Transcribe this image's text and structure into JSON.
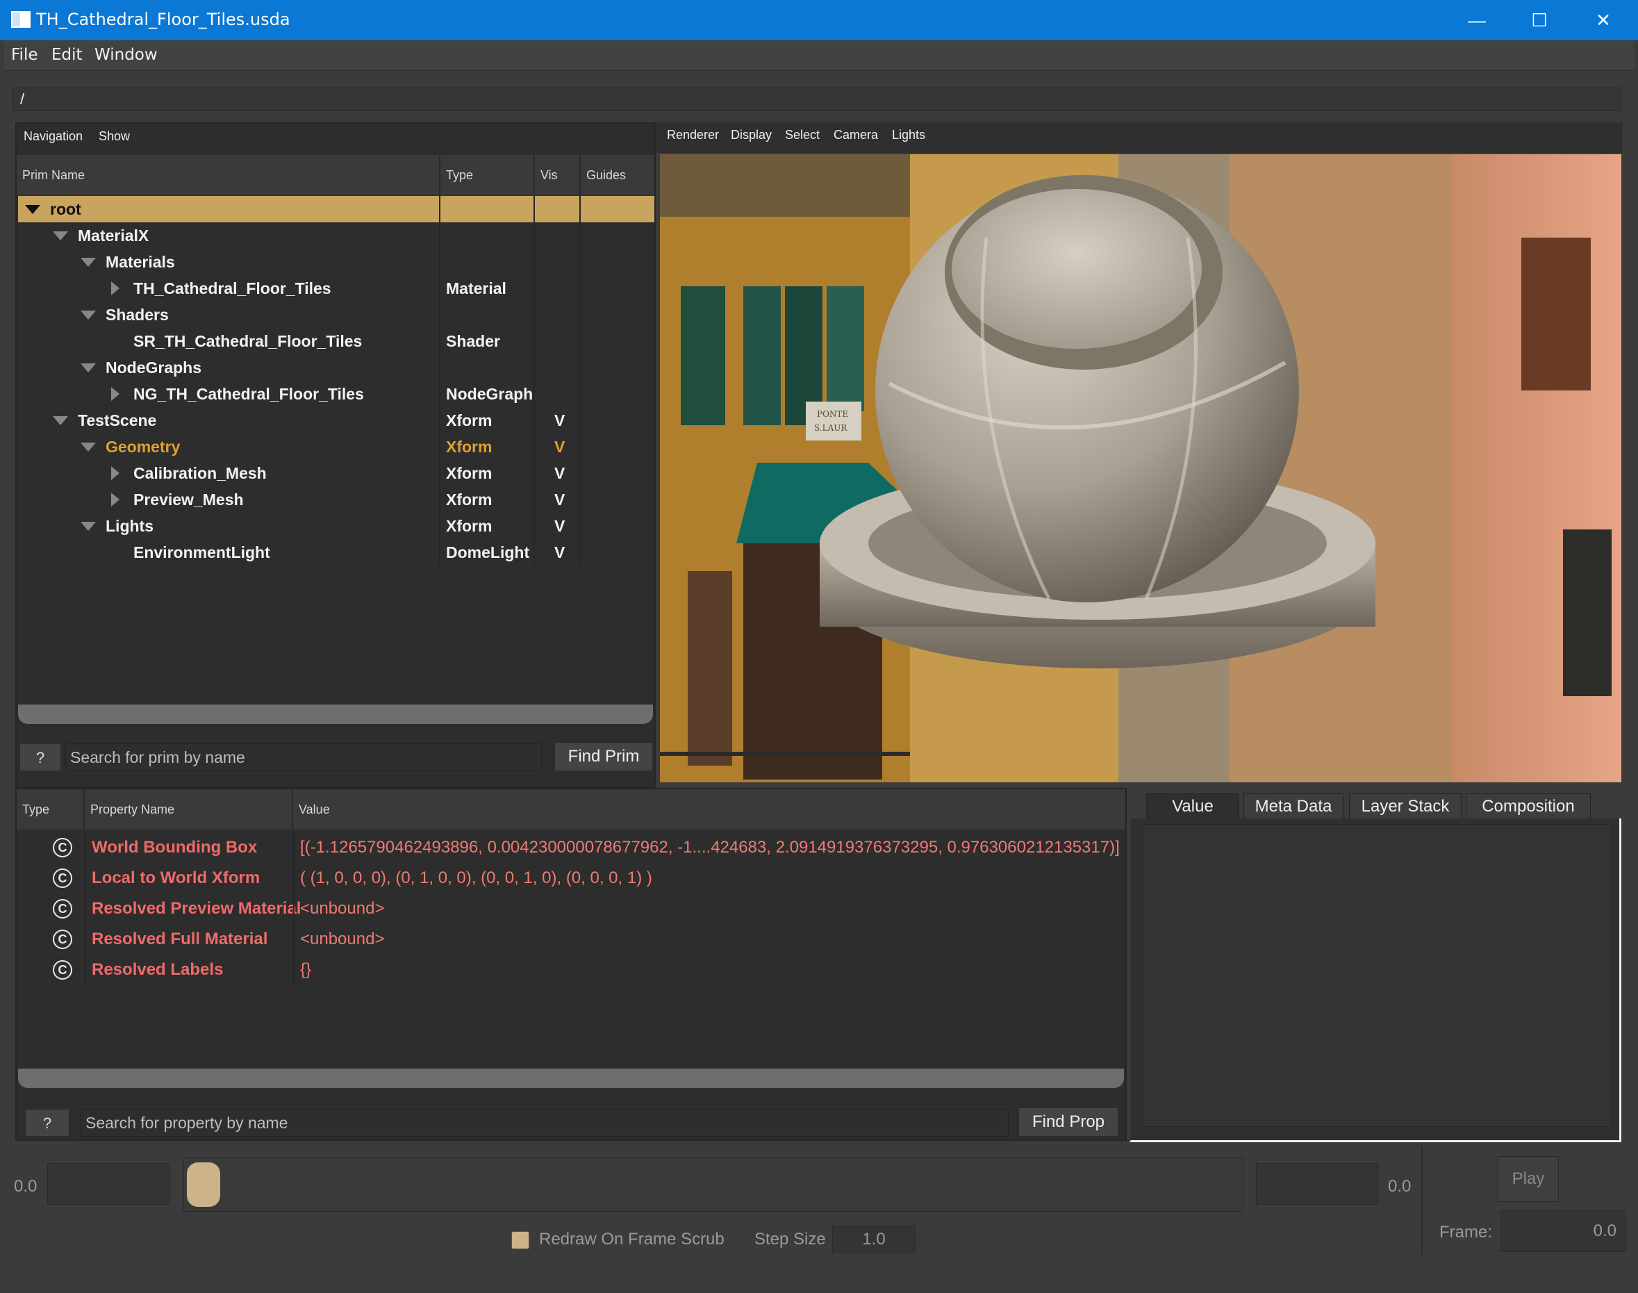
{
  "window": {
    "title": "TH_Cathedral_Floor_Tiles.usda",
    "min": "—",
    "max": "☐",
    "close": "✕"
  },
  "menubar": [
    "File",
    "Edit",
    "Window"
  ],
  "path": "/",
  "browser": {
    "menu": [
      "Navigation",
      "Show"
    ],
    "columns": [
      "Prim Name",
      "Type",
      "Vis",
      "Guides"
    ],
    "rows": [
      {
        "name": "root",
        "type": "",
        "vis": ""
      },
      {
        "name": "MaterialX",
        "type": "",
        "vis": ""
      },
      {
        "name": "Materials",
        "type": "",
        "vis": ""
      },
      {
        "name": "TH_Cathedral_Floor_Tiles",
        "type": "Material",
        "vis": ""
      },
      {
        "name": "Shaders",
        "type": "",
        "vis": ""
      },
      {
        "name": "SR_TH_Cathedral_Floor_Tiles",
        "type": "Shader",
        "vis": ""
      },
      {
        "name": "NodeGraphs",
        "type": "",
        "vis": ""
      },
      {
        "name": "NG_TH_Cathedral_Floor_Tiles",
        "type": "NodeGraph",
        "vis": ""
      },
      {
        "name": "TestScene",
        "type": "Xform",
        "vis": "V"
      },
      {
        "name": "Geometry",
        "type": "Xform",
        "vis": "V"
      },
      {
        "name": "Calibration_Mesh",
        "type": "Xform",
        "vis": "V"
      },
      {
        "name": "Preview_Mesh",
        "type": "Xform",
        "vis": "V"
      },
      {
        "name": "Lights",
        "type": "Xform",
        "vis": "V"
      },
      {
        "name": "EnvironmentLight",
        "type": "DomeLight",
        "vis": "V"
      }
    ],
    "help": "?",
    "search_placeholder": "Search for prim by name",
    "find_label": "Find Prim"
  },
  "viewport": {
    "menu": [
      "Renderer",
      "Display",
      "Select",
      "Camera",
      "Lights"
    ],
    "sign_text": [
      "PONTE",
      "S.LAUR"
    ]
  },
  "properties": {
    "columns": [
      "Type",
      "Property Name",
      "Value"
    ],
    "icon_letter": "C",
    "rows": [
      {
        "name": "World Bounding Box",
        "value": "[(-1.1265790462493896, 0.004230000078677962, -1....424683, 2.0914919376373295, 0.9763060212135317)]"
      },
      {
        "name": "Local to World Xform",
        "value": "( (1, 0, 0, 0), (0, 1, 0, 0), (0, 0, 1, 0), (0, 0, 0, 1) )"
      },
      {
        "name": "Resolved Preview Material",
        "value": "<unbound>"
      },
      {
        "name": "Resolved Full Material",
        "value": "<unbound>"
      },
      {
        "name": "Resolved Labels",
        "value": "{}"
      }
    ],
    "help": "?",
    "search_placeholder": "Search for property by name",
    "find_label": "Find Prop"
  },
  "tabs": [
    "Value",
    "Meta Data",
    "Layer Stack",
    "Composition"
  ],
  "timeline": {
    "start": "0.0",
    "end": "0.0",
    "play": "Play",
    "redraw_label": "Redraw On Frame Scrub",
    "step_label": "Step Size",
    "step_value": "1.0",
    "frame_label": "Frame:",
    "frame_value": "0.0"
  },
  "colors": {
    "titlebar": "#0a78d4",
    "selection": "#c8a45e",
    "highlight_text": "#e0a030",
    "property_text": "#f06a6a"
  }
}
